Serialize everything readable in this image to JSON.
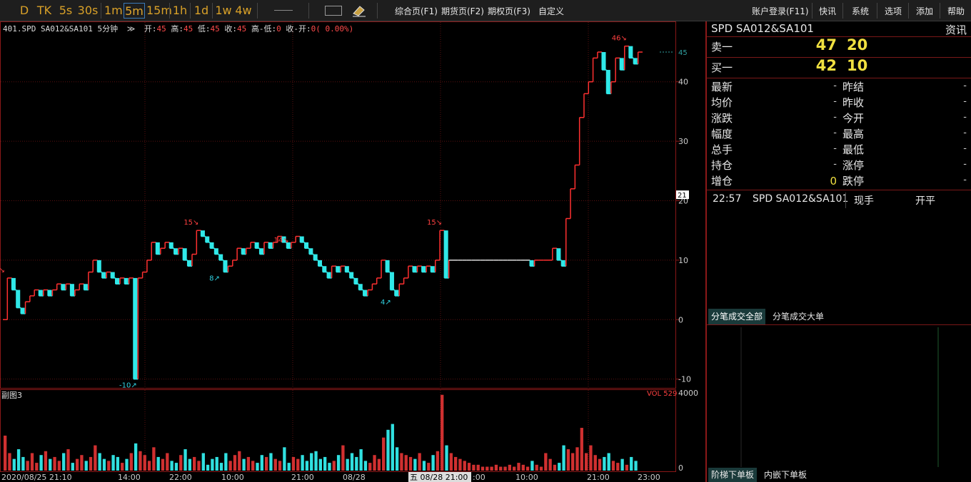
{
  "toolbar": {
    "periods": [
      "D",
      "TK",
      "5s",
      "30s",
      "1m",
      "5m",
      "15m",
      "1h",
      "1d",
      "1w",
      "4w"
    ],
    "menus": [
      "综合页(F1)",
      "期货页(F2)",
      "期权页(F3)",
      "自定义"
    ],
    "right_menus": [
      "账户登录(F11)",
      "快讯",
      "系统",
      "选项",
      "添加",
      "帮助"
    ]
  },
  "chart": {
    "info_prefix": "401.SPD SA012&SA101 5分钟",
    "info_open_label": "开:",
    "info_open": "45",
    "info_high_label": "高:",
    "info_high": "45",
    "info_low_label": "低:",
    "info_low": "45",
    "info_close_label": "收:",
    "info_close": "45",
    "info_hl_label": "高-低:",
    "info_hl": "0",
    "info_co_label": "收-开:",
    "info_co": "0( 0.00%)",
    "sub_title": "副图3",
    "vol_label": "VOL 529",
    "current_price_tag": "21",
    "last_price_tag": "45",
    "time_labels": [
      "2020/08/25 21:10",
      "14:00",
      "22:00",
      "10:00",
      "21:00",
      "08/28",
      "五 08/28 21:00",
      ":00",
      "10:00",
      "21:00",
      "23:00"
    ]
  },
  "chart_data": {
    "type": "line",
    "title": "401.SPD SA012&SA101 5分钟",
    "y_ticks": [
      40,
      30,
      20,
      10,
      0,
      -10
    ],
    "ylim": [
      -11,
      48
    ],
    "vol_ticks": [
      4000,
      0
    ],
    "annotations": [
      "7",
      "0",
      "-10",
      "15",
      "8",
      "14",
      "15",
      "4",
      "46"
    ],
    "series": [
      {
        "name": "SPD SA012&SA101",
        "values": [
          0,
          7,
          5,
          2,
          1,
          3,
          4,
          5,
          4,
          5,
          4,
          5,
          6,
          5,
          6,
          4,
          5,
          6,
          5,
          8,
          10,
          8,
          7,
          8,
          7,
          6,
          7,
          6,
          7,
          -10,
          7,
          8,
          10,
          13,
          11,
          12,
          13,
          12,
          11,
          12,
          10,
          9,
          11,
          15,
          14,
          13,
          12,
          11,
          10,
          8,
          9,
          10,
          12,
          11,
          12,
          13,
          12,
          11,
          13,
          12,
          13,
          14,
          13,
          12,
          13,
          14,
          13,
          12,
          11,
          10,
          9,
          8,
          7,
          9,
          8,
          9,
          8,
          7,
          6,
          5,
          4,
          5,
          6,
          7,
          10,
          8,
          5,
          4,
          6,
          7,
          9,
          8,
          9,
          8,
          9,
          8,
          10,
          15,
          7,
          10,
          10,
          10,
          10,
          10,
          10,
          10,
          10,
          10,
          10,
          10,
          10,
          10,
          10,
          10,
          10,
          10,
          10,
          9,
          10,
          10,
          10,
          10,
          12,
          10,
          9,
          17,
          22,
          26,
          34,
          38,
          40,
          44,
          45,
          42,
          38,
          40,
          44,
          42,
          46,
          44,
          43,
          45
        ]
      }
    ],
    "volume": [
      1800,
      900,
      600,
      1100,
      700,
      500,
      900,
      400,
      800,
      1000,
      600,
      700,
      500,
      900,
      1100,
      400,
      600,
      800,
      500,
      700,
      1300,
      900,
      600,
      500,
      800,
      700,
      400,
      600,
      900,
      1400,
      1000,
      800,
      500,
      1200,
      700,
      600,
      900,
      500,
      400,
      800,
      1100,
      600,
      700,
      500,
      900,
      300,
      600,
      700,
      400,
      900,
      500,
      800,
      1000,
      600,
      700,
      500,
      400,
      800,
      700,
      900,
      600,
      500,
      1200,
      400,
      700,
      600,
      800,
      500,
      900,
      1000,
      600,
      700,
      400,
      500,
      800,
      1300,
      600,
      900,
      700,
      1100,
      500,
      400,
      800,
      600,
      1700,
      2100,
      2400,
      1200,
      900,
      800,
      700,
      600,
      900,
      500,
      400,
      800,
      1000,
      3900,
      1300,
      900,
      700,
      600,
      500,
      400,
      300,
      300,
      200,
      200,
      200,
      300,
      200,
      200,
      300,
      200,
      400,
      300,
      200,
      500,
      300,
      200,
      900,
      600,
      300,
      400,
      1300,
      1100,
      900,
      1200,
      2200,
      900,
      1300,
      800,
      600,
      700,
      900,
      500,
      400,
      600,
      300,
      700,
      500
    ]
  },
  "quote": {
    "title": "SPD SA012&SA101",
    "news": "资讯",
    "ask_label": "卖一",
    "ask_price": "47",
    "ask_vol": "20",
    "bid_label": "买一",
    "bid_price": "42",
    "bid_vol": "10",
    "stats_left": [
      {
        "label": "最新",
        "value": "-"
      },
      {
        "label": "均价",
        "value": "-"
      },
      {
        "label": "涨跌",
        "value": "-"
      },
      {
        "label": "幅度",
        "value": "-"
      },
      {
        "label": "总手",
        "value": "-"
      },
      {
        "label": "持仓",
        "value": "-"
      },
      {
        "label": "增仓",
        "value": "0"
      }
    ],
    "stats_right": [
      {
        "label": "昨结",
        "value": "-"
      },
      {
        "label": "昨收",
        "value": "-"
      },
      {
        "label": "今开",
        "value": "-"
      },
      {
        "label": "最高",
        "value": "-"
      },
      {
        "label": "最低",
        "value": "-"
      },
      {
        "label": "涨停",
        "value": "-"
      },
      {
        "label": "跌停",
        "value": "-"
      }
    ],
    "tick_time": "22:57",
    "tick_symbol": "SPD SA012&SA101",
    "tick_type": "现手",
    "tick_action": "开平",
    "tabs": [
      "分笔成交全部",
      "分笔成交大单"
    ],
    "bottom_tabs": [
      "阶梯下单板",
      "内嵌下单板"
    ]
  }
}
